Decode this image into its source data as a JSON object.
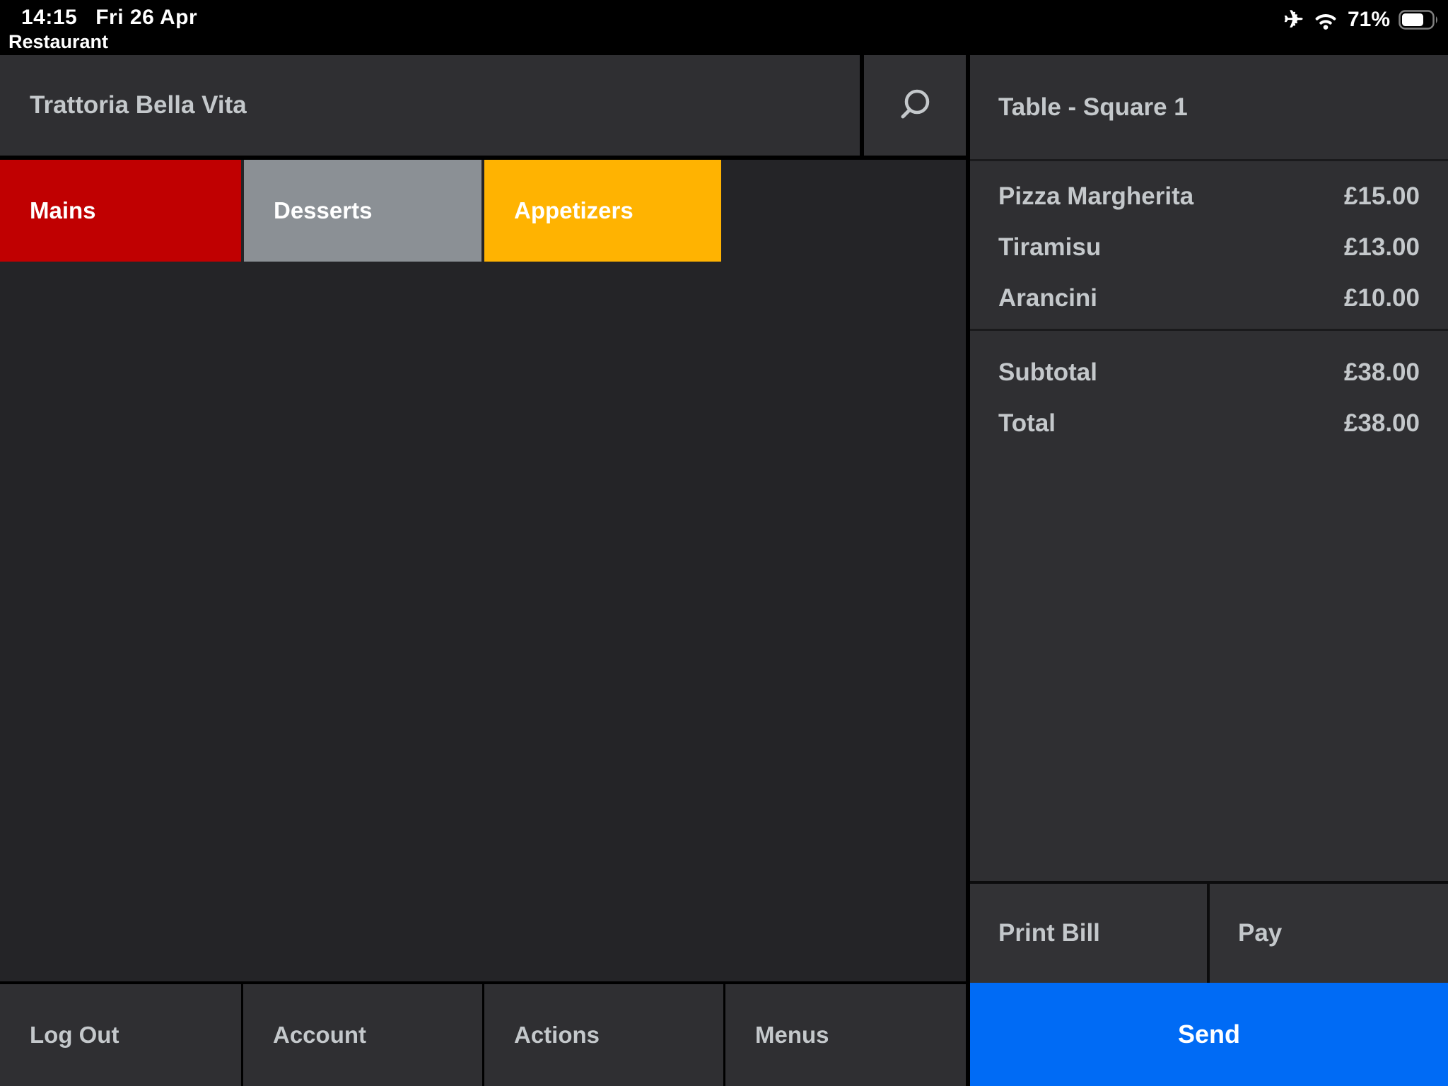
{
  "status_bar": {
    "time": "14:15",
    "date": "Fri 26 Apr",
    "app_label": "Restaurant",
    "battery_percent": "71%",
    "battery_level": 0.71,
    "icons": [
      "airplane-mode-icon",
      "wifi-icon",
      "battery-icon"
    ]
  },
  "header": {
    "title": "Trattoria Bella Vita",
    "search_icon": "magnifying-glass"
  },
  "tabs": [
    {
      "label": "Mains",
      "color": "#c00001"
    },
    {
      "label": "Desserts",
      "color": "#8b9095"
    },
    {
      "label": "Appetizers",
      "color": "#ffb301"
    }
  ],
  "order_panel": {
    "title": "Table - Square 1",
    "items": [
      {
        "name": "Pizza Margherita",
        "price": "£15.00"
      },
      {
        "name": "Tiramisu",
        "price": "£13.00"
      },
      {
        "name": "Arancini",
        "price": "£10.00"
      }
    ],
    "totals": [
      {
        "label": "Subtotal",
        "value": "£38.00"
      },
      {
        "label": "Total",
        "value": "£38.00"
      }
    ],
    "actions": {
      "print_bill": "Print Bill",
      "pay": "Pay",
      "send": "Send"
    },
    "send_color": "#006bf5"
  },
  "bottom_nav": [
    {
      "label": "Log Out"
    },
    {
      "label": "Account"
    },
    {
      "label": "Actions"
    },
    {
      "label": "Menus"
    }
  ],
  "colors": {
    "status_bar_bg": "#000000",
    "panel_bg": "#2f2f32",
    "content_bg": "#242427",
    "text_light": "#c4c8cb",
    "divider": "#1a1a1c"
  }
}
